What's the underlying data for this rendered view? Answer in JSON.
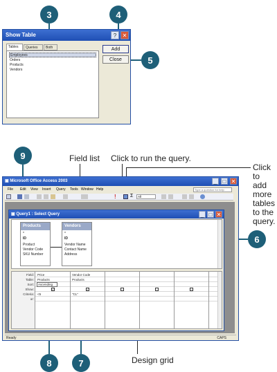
{
  "callouts": {
    "c3": "3",
    "c4": "4",
    "c5": "5",
    "c9": "9",
    "c6": "6",
    "c8": "8",
    "c7": "7"
  },
  "captions": {
    "field_list": "Field list",
    "run_query": "Click to run the query.",
    "add_tables": [
      "Click to",
      "add",
      "more",
      "tables",
      "to the",
      "query."
    ],
    "design_grid": "Design grid"
  },
  "show_table": {
    "title": "Show Table",
    "tabs": [
      "Tables",
      "Queries",
      "Both"
    ],
    "items": [
      "Employees",
      "Orders",
      "Products",
      "Vendors"
    ],
    "add_label": "Add",
    "close_label": "Close"
  },
  "access": {
    "title": "Microsoft Office Access 2003",
    "menus": [
      "File",
      "Edit",
      "View",
      "Insert",
      "Query",
      "Tools",
      "Window",
      "Help"
    ],
    "help_placeholder": "Type a question for help",
    "top_values": "All",
    "query_title": "Query1 : Select Query",
    "products_table": {
      "name": "Products",
      "fields": [
        "*",
        "ID",
        "Product",
        "Vendor Code",
        "SKU Number"
      ]
    },
    "vendors_table": {
      "name": "Vendors",
      "fields": [
        "*",
        "ID",
        "Vendor Name",
        "Contact Name",
        "Address"
      ]
    },
    "row_labels": [
      "Field:",
      "Table:",
      "Sort:",
      "Show:",
      "Criteria:",
      "or:"
    ],
    "col1": {
      "field": "Price",
      "table": "Products",
      "sort": "Ascending",
      "criteria": "<5"
    },
    "col2": {
      "field": "Vendor Code",
      "table": "Products",
      "criteria": "\"CL\""
    },
    "status_left": "Ready",
    "status_right": "CAPS"
  }
}
